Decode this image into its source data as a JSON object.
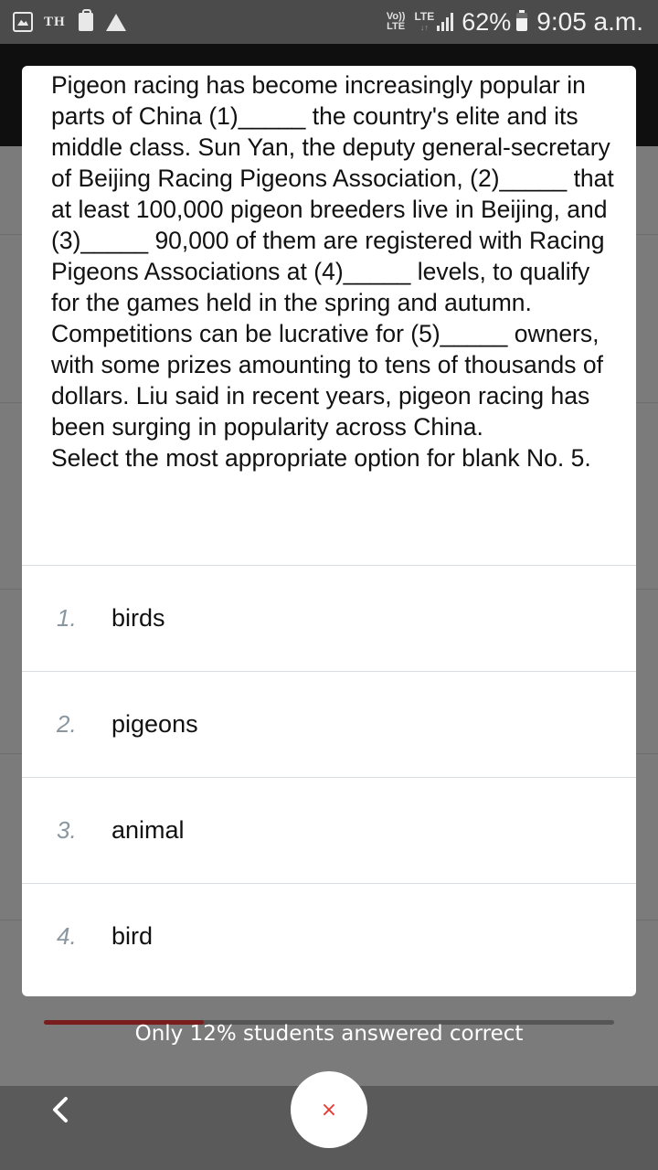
{
  "status_bar": {
    "carrier_badge": "TH",
    "volte_top": "Vo))",
    "volte_bottom": "LTE",
    "lte_top": "LTE",
    "lte_bottom": "↓↑",
    "battery_percent": "62%",
    "time": "9:05 a.m.",
    "icons": [
      "gallery-icon",
      "shopping-bag-icon",
      "drive-icon",
      "signal-icon",
      "battery-icon"
    ]
  },
  "question": {
    "passage": "Pigeon racing has become increasingly popular in parts of China (1)_____ the country's elite and its middle class. Sun Yan, the deputy general-secretary of Beijing Racing Pigeons Association, (2)_____ that at least 100,000 pigeon breeders live in Beijing, and (3)_____ 90,000 of them are registered with Racing Pigeons Associations at (4)_____ levels, to qualify for the games held in the spring and autumn. Competitions can be lucrative for (5)_____ owners, with some prizes amounting to tens of thousands of dollars. Liu said in recent years, pigeon racing has been surging in popularity across China.",
    "prompt": "Select the most appropriate option for blank No. 5."
  },
  "options": [
    {
      "number": "1.",
      "label": "birds"
    },
    {
      "number": "2.",
      "label": "pigeons"
    },
    {
      "number": "3.",
      "label": "animal"
    },
    {
      "number": "4.",
      "label": "bird"
    }
  ],
  "footer": {
    "stat_text": "Only 12% students answered correct",
    "progress_fraction": 0.28,
    "back_icon": "chevron-left-icon",
    "close_label": "×"
  },
  "colors": {
    "progress_fill": "#7a1d1d",
    "close_icon": "#e53935",
    "option_number": "#8a97a0"
  }
}
